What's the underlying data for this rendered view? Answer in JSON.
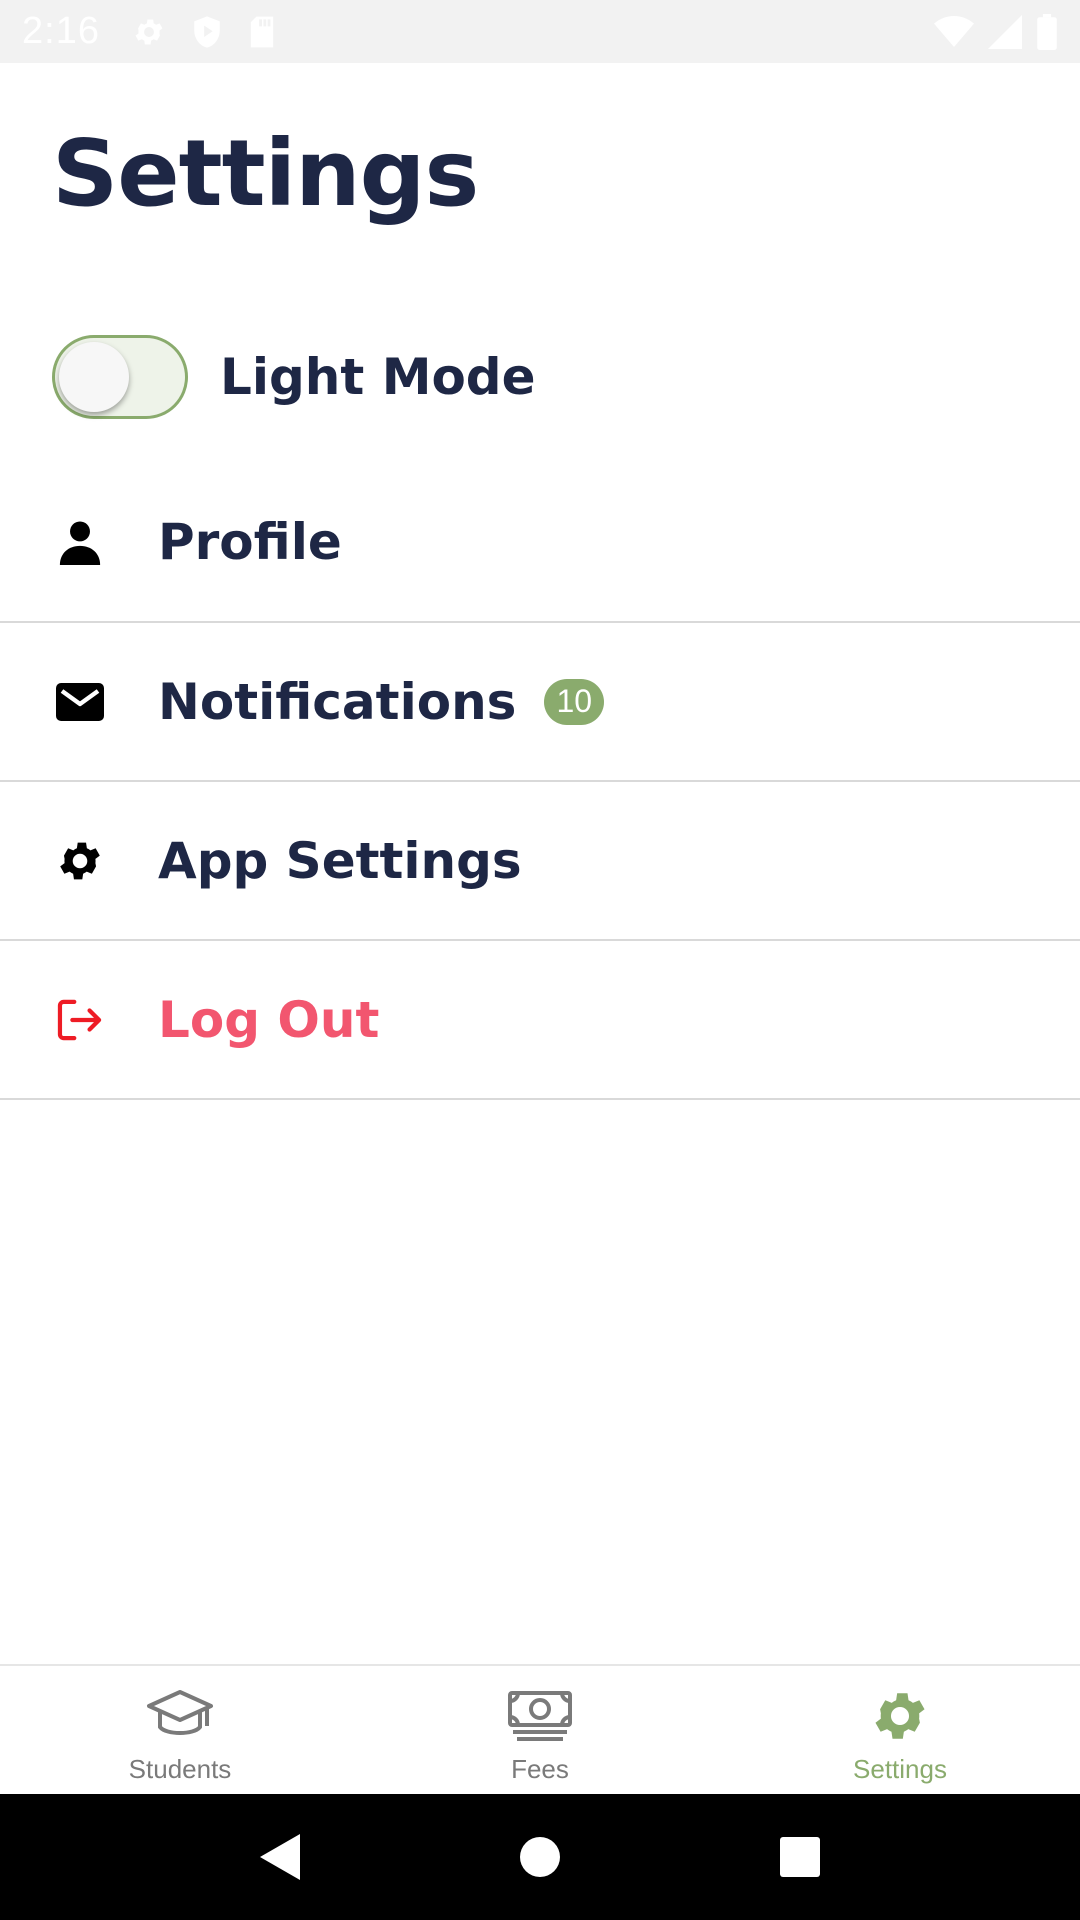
{
  "status_bar": {
    "time": "2:16",
    "left_icons": [
      "gear-icon",
      "shield-play-icon",
      "sd-card-icon"
    ],
    "right_icons": [
      "wifi-icon",
      "cell-signal-icon",
      "battery-icon"
    ]
  },
  "page": {
    "title": "Settings"
  },
  "theme_toggle": {
    "label": "Light Mode",
    "on": false,
    "accent_color": "#8aab6d"
  },
  "menu": {
    "items": [
      {
        "label": "Profile",
        "icon": "person-icon"
      },
      {
        "label": "Notifications",
        "icon": "envelope-icon",
        "badge": "10"
      },
      {
        "label": "App Settings",
        "icon": "gear-icon"
      },
      {
        "label": "Log Out",
        "icon": "logout-icon",
        "color": "#f2566f"
      }
    ]
  },
  "tab_bar": {
    "tabs": [
      {
        "label": "Students",
        "icon": "graduation-cap-icon",
        "active": false
      },
      {
        "label": "Fees",
        "icon": "money-bill-icon",
        "active": false
      },
      {
        "label": "Settings",
        "icon": "gear-icon",
        "active": true
      }
    ],
    "active_color": "#8aab6d",
    "inactive_color": "#7a7a7a"
  },
  "nav_bar": {
    "buttons": [
      "back-icon",
      "home-icon",
      "recents-icon"
    ]
  },
  "colors": {
    "text_primary": "#1e2745",
    "danger": "#f2566f",
    "divider": "#d9d9d9"
  }
}
